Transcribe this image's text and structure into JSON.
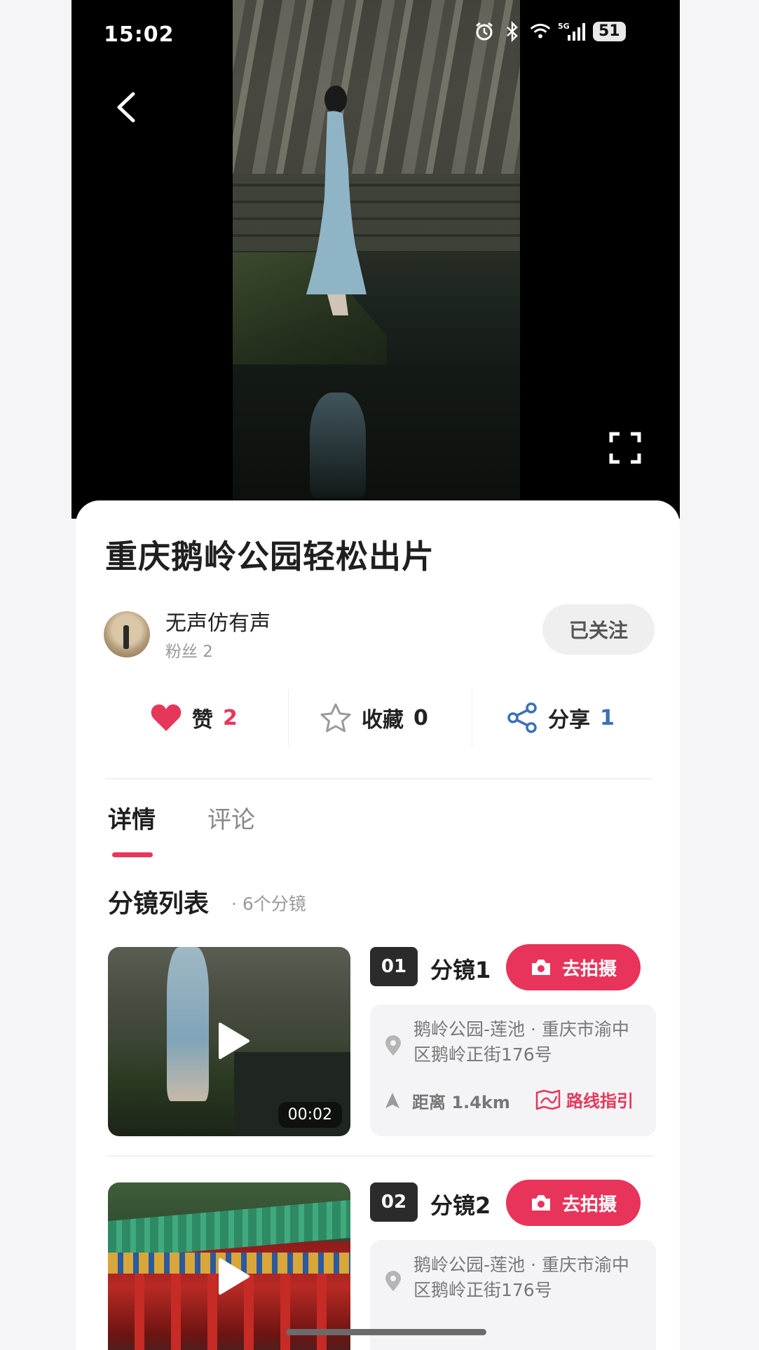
{
  "status_bar": {
    "time": "15:02",
    "battery": "51",
    "network": "5G"
  },
  "video": {
    "title": ""
  },
  "post": {
    "title": "重庆鹅岭公园轻松出片",
    "author": {
      "name": "无声仿有声",
      "fans": "粉丝 2"
    },
    "follow_label": "已关注"
  },
  "actions": {
    "like": {
      "label": "赞",
      "count": "2",
      "icon": "heart-icon",
      "color": "#e6375a"
    },
    "favorite": {
      "label": "收藏",
      "count": "0",
      "icon": "star-icon"
    },
    "share": {
      "label": "分享",
      "count": "1",
      "icon": "share-icon",
      "color": "#3d6fb8"
    }
  },
  "tabs": [
    {
      "label": "详情",
      "active": true
    },
    {
      "label": "评论",
      "active": false
    }
  ],
  "section": {
    "title": "分镜列表",
    "count": "· 6个分镜"
  },
  "shots": [
    {
      "num": "01",
      "name": "分镜1",
      "shoot_label": "去拍摄",
      "duration": "00:02",
      "address": "鹅岭公园-莲池 · 重庆市渝中区鹅岭正街176号",
      "distance": "距离 1.4km",
      "route_label": "路线指引"
    },
    {
      "num": "02",
      "name": "分镜2",
      "shoot_label": "去拍摄",
      "address": "鹅岭公园-莲池 · 重庆市渝中区鹅岭正街176号"
    }
  ],
  "colors": {
    "accent": "#e8345a",
    "background": "#f5f5f7"
  }
}
